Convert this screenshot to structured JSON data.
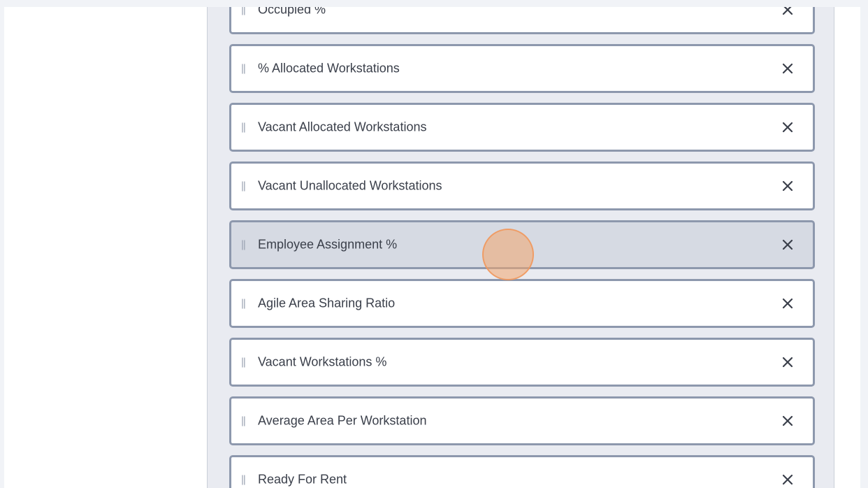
{
  "fields": [
    {
      "label": "Occupied %",
      "drag_glyph": "||",
      "remove_glyph": "×",
      "hovered": false
    },
    {
      "label": "% Allocated Workstations",
      "drag_glyph": "||",
      "remove_glyph": "×",
      "hovered": false
    },
    {
      "label": "Vacant Allocated Workstations",
      "drag_glyph": "||",
      "remove_glyph": "×",
      "hovered": false
    },
    {
      "label": "Vacant Unallocated Workstations",
      "drag_glyph": "||",
      "remove_glyph": "×",
      "hovered": false
    },
    {
      "label": "Employee Assignment %",
      "drag_glyph": "||",
      "remove_glyph": "×",
      "hovered": true
    },
    {
      "label": "Agile Area Sharing Ratio",
      "drag_glyph": "||",
      "remove_glyph": "×",
      "hovered": false
    },
    {
      "label": "Vacant Workstations %",
      "drag_glyph": "||",
      "remove_glyph": "×",
      "hovered": false
    },
    {
      "label": "Average Area Per Workstation",
      "drag_glyph": "||",
      "remove_glyph": "×",
      "hovered": false
    },
    {
      "label": "Ready For Rent",
      "drag_glyph": "||",
      "remove_glyph": "×",
      "hovered": false
    }
  ],
  "icons": {
    "drag": "drag-handle-icon",
    "remove": "close-icon"
  },
  "colors": {
    "page_background": "#f1f3f7",
    "panel_background": "#e9ebf1",
    "item_border": "#8d98ad",
    "item_hover_background": "#d6dae3",
    "click_indicator": "#f3a56e"
  }
}
